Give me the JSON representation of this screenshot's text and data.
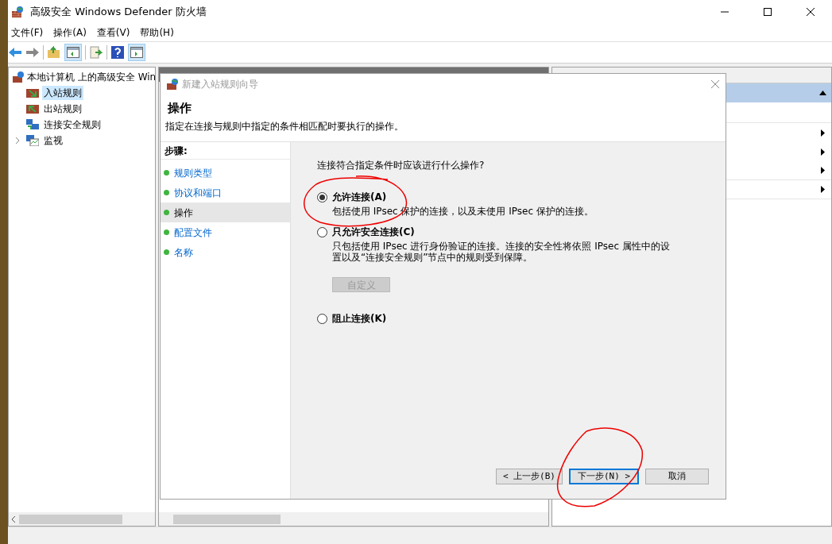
{
  "window": {
    "title": "高级安全 Windows Defender 防火墙"
  },
  "menu": [
    "文件(F)",
    "操作(A)",
    "查看(V)",
    "帮助(H)"
  ],
  "tree": {
    "label": "本地计算机 上的高级安全 Win",
    "children": [
      {
        "label": "入站规则",
        "selected": true,
        "kind": "inbound"
      },
      {
        "label": "出站规则",
        "selected": false,
        "kind": "outbound"
      },
      {
        "label": "连接安全规则",
        "selected": false,
        "kind": "connection"
      },
      {
        "label": "监视",
        "selected": false,
        "kind": "monitor"
      }
    ]
  },
  "dialog": {
    "title": "新建入站规则向导",
    "heading": "操作",
    "description": "指定在连接与规则中指定的条件相匹配时要执行的操作。",
    "steps_title": "步骤:",
    "steps": [
      {
        "label": "规则类型",
        "selected": false
      },
      {
        "label": "协议和端口",
        "selected": false
      },
      {
        "label": "操作",
        "selected": true
      },
      {
        "label": "配置文件",
        "selected": false
      },
      {
        "label": "名称",
        "selected": false
      }
    ],
    "question": "连接符合指定条件时应该进行什么操作?",
    "options": [
      {
        "label": "允许连接(A)",
        "description": "包括使用 IPsec 保护的连接，以及未使用 IPsec 保护的连接。",
        "selected": true
      },
      {
        "label": "只允许安全连接(C)",
        "description": "只包括使用 IPsec 进行身份验证的连接。连接的安全性将依照 IPsec 属性中的设置以及“连接安全规则”节点中的规则受到保障。",
        "selected": false,
        "button": {
          "label": "自定义",
          "disabled": true
        }
      },
      {
        "label": "阻止连接(K)",
        "selected": false
      }
    ],
    "buttons": [
      {
        "label": "< 上一步(B)",
        "focused": false
      },
      {
        "label": "下一步(N) >",
        "focused": true
      },
      {
        "label": "取消",
        "focused": false
      }
    ]
  }
}
